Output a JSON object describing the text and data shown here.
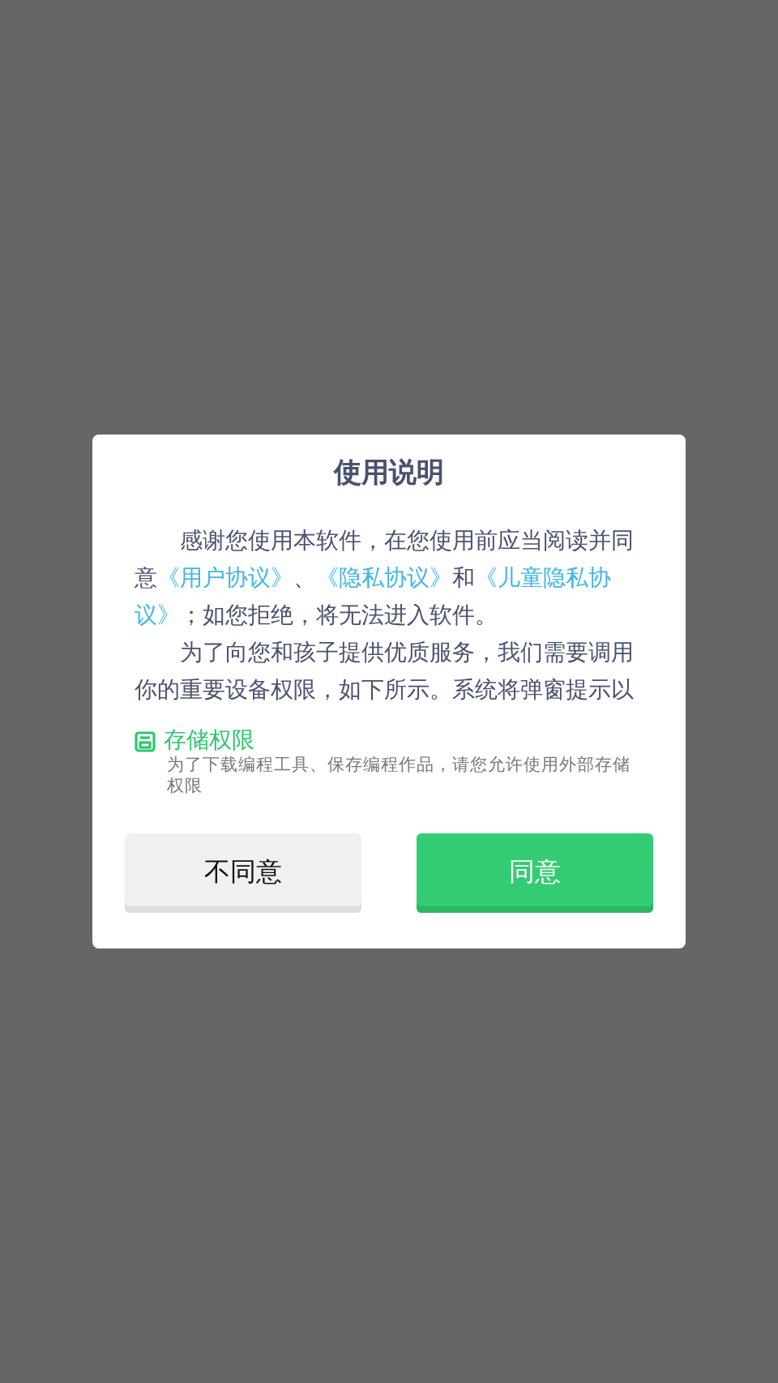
{
  "dialog": {
    "title": "使用说明",
    "paragraphs": [
      {
        "segments": [
          {
            "kind": "text",
            "text": "感谢您使用本软件，在您使用前应当阅读并同意"
          },
          {
            "kind": "link",
            "text": "《用户协议》"
          },
          {
            "kind": "text",
            "text": "、"
          },
          {
            "kind": "link",
            "text": "《隐私协议》"
          },
          {
            "kind": "text",
            "text": "和"
          },
          {
            "kind": "link",
            "text": "《儿童隐私协"
          },
          {
            "kind": "link",
            "text": "议》"
          },
          {
            "kind": "text",
            "text": "；如您拒绝，将无法进入软件。"
          }
        ]
      },
      {
        "segments": [
          {
            "kind": "text",
            "text": "为了向您和孩子提供优质服务，我们需要调用你的重要设备权限，如下所示。系统将弹窗提示以"
          }
        ]
      }
    ],
    "permissions": [
      {
        "name": "存储权限",
        "description": "为了下载编程工具、保存编程作品，请您允许使用外部存储权限"
      }
    ],
    "buttons": [
      {
        "label": "不同意",
        "kind": "secondary"
      },
      {
        "label": "同意",
        "kind": "primary"
      }
    ]
  }
}
